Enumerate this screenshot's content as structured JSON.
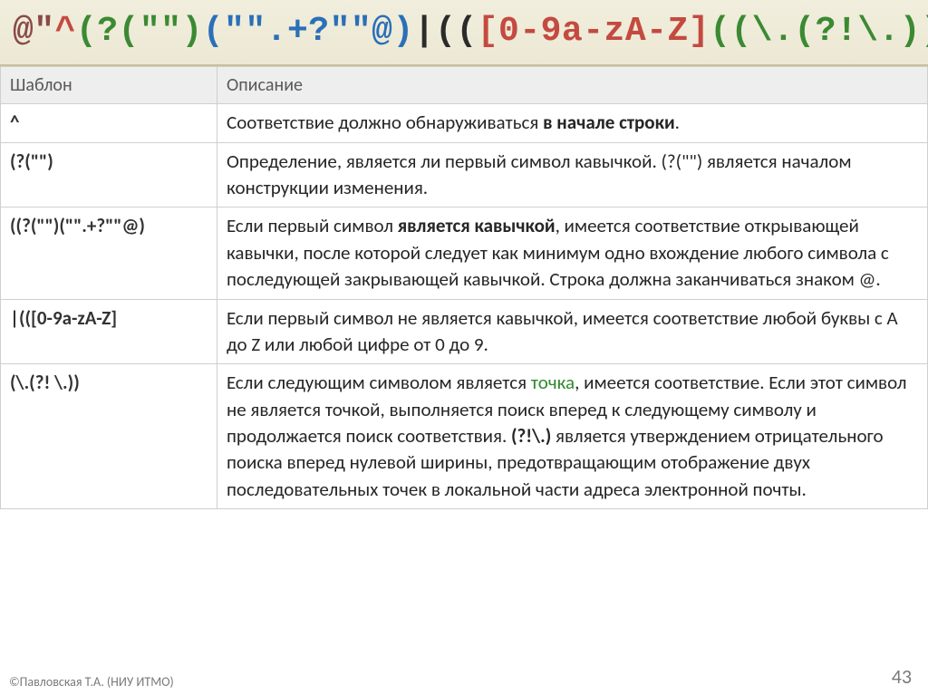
{
  "title_parts": {
    "p0": "@\"",
    "p1": "^",
    "p2": "(?(\"\")",
    "p3": "(\"\".+?\"\"@)",
    "p4": "|",
    "p5": "((",
    "p6": "[0-9a-zA-Z]",
    "p7": "((\\.(?!\\.))"
  },
  "headers": {
    "pattern": "Шаблон",
    "description": "Описание"
  },
  "rows": {
    "r0": {
      "pat": "^",
      "desc_a": "Соответствие должно обнаруживаться ",
      "desc_b": "в начале строки",
      "desc_c": "."
    },
    "r1": {
      "pat": "(?(\"\")",
      "desc": "Определение, является ли первый символ кавычкой. (?(\"\") является началом конструкции изменения."
    },
    "r2": {
      "pat": "((?(\"\")(\"\".+?\"\"@)",
      "desc_a": "Если первый символ ",
      "desc_b": "является кавычкой",
      "desc_c": ", имеется соответствие открывающей кавычки, после которой следует как минимум одно вхождение любого символа с последующей закрывающей кавычкой. Строка должна заканчиваться знаком @."
    },
    "r3": {
      "pat": "|(([0-9a-zA-Z]",
      "desc": "Если первый символ не является кавычкой, имеется соответствие любой буквы с A до Z или любой цифре от 0 до 9."
    },
    "r4": {
      "pat": "(\\.(?! \\.))",
      "desc_a": "Если следующим символом является ",
      "desc_b": "точка",
      "desc_c": ", имеется соответствие. Если этот символ не является точкой, выполняется поиск вперед к следующему символу и продолжается поиск соответствия. ",
      "desc_d": "(?!\\.)",
      "desc_e": " является утверждением отрицательного поиска вперед нулевой ширины, предотвращающим отображение двух последовательных точек в локальной части адреса электронной почты."
    }
  },
  "footer": "©Павловская Т.А. (НИУ ИТМО)",
  "page": "43"
}
